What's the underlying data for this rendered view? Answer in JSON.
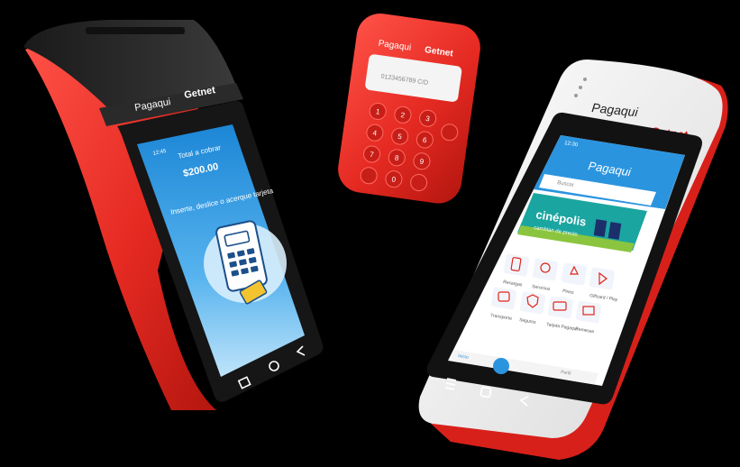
{
  "colors": {
    "background": "#000000",
    "device_red": "#e8322b",
    "device_white": "#f2f2f2",
    "screen_blue": "#1f8fdc",
    "getnet_red": "#e2231a"
  },
  "device_left": {
    "brand": "Pagaqui",
    "partner": "Getnet",
    "status_time": "12:45",
    "total_label": "Total a cobrar",
    "amount": "$200.00",
    "instruction": "Inserte, deslice o acerque tarjeta",
    "icons": [
      "card-reader-icon",
      "square-nav-icon",
      "home-nav-icon",
      "back-nav-icon"
    ]
  },
  "device_middle": {
    "brand": "Pagaqui",
    "partner": "Getnet",
    "display": "0123456789 C/D",
    "keys": [
      "1",
      "2",
      "3",
      "4",
      "5",
      "6",
      "7",
      "8",
      "9",
      "",
      "0",
      ""
    ]
  },
  "device_right": {
    "brand": "Pagaqui",
    "partner": "Getnet",
    "status_time": "12:30",
    "search_placeholder": "Buscar",
    "banner_text": "cinépolis",
    "banner_sub": "cambian de precio",
    "services": [
      {
        "label": "Recargas",
        "icon": "phone-icon"
      },
      {
        "label": "Servicios",
        "icon": "bulb-icon"
      },
      {
        "label": "Pines",
        "icon": "pin-icon"
      },
      {
        "label": "Giftcard / Play",
        "icon": "play-icon"
      },
      {
        "label": "Transporte",
        "icon": "bus-icon"
      },
      {
        "label": "Seguros",
        "icon": "shield-icon"
      },
      {
        "label": "Tarjeta Pagaqui",
        "icon": "card-icon"
      },
      {
        "label": "Remesas",
        "icon": "gift-icon"
      }
    ],
    "bottom_nav": [
      "Inicio",
      "",
      "Perfil"
    ]
  }
}
